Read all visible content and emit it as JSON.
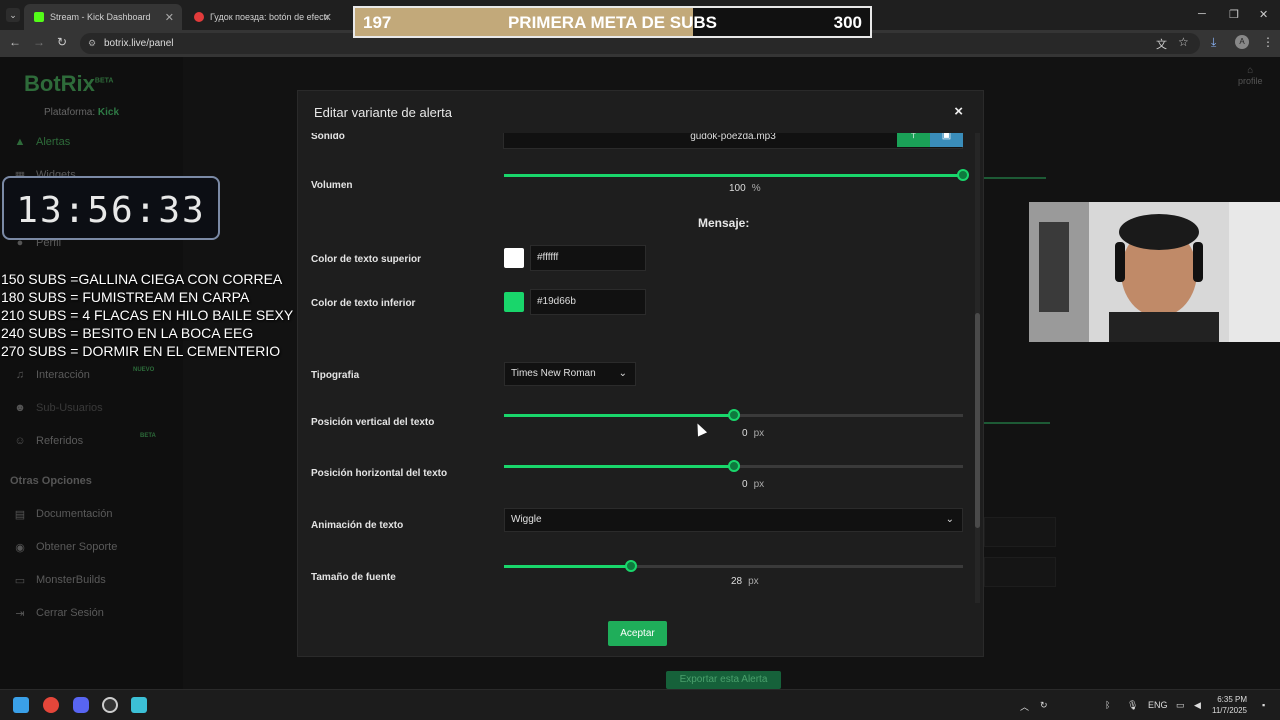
{
  "browser": {
    "tabs": [
      {
        "label": "Stream - Kick Dashboard",
        "color": "#53fc18"
      },
      {
        "label": "Гудок поезда: botón de efecto",
        "color": "#e23b3b"
      }
    ],
    "url": "botrix.live/panel"
  },
  "sidebar": {
    "logo": "BotRix",
    "logo_badge": "BETA",
    "platform_label": "Plataforma:",
    "platform_value": "Kick",
    "items": [
      {
        "label": "Alertas",
        "icon": "warning-icon"
      },
      {
        "label": "Widgets",
        "icon": "widget-icon"
      },
      {
        "label": "Perfil",
        "icon": "user-icon"
      },
      {
        "label": "Interacción",
        "icon": "music-note-icon",
        "badge": "NUEVO"
      },
      {
        "label": "Sub-Usuarios",
        "icon": "users-icon"
      },
      {
        "label": "Referidos",
        "icon": "group-icon",
        "badge": "BETA"
      }
    ],
    "section_title": "Otras Opciones",
    "other_items": [
      {
        "label": "Documentación",
        "icon": "doc-icon"
      },
      {
        "label": "Obtener Soporte",
        "icon": "support-icon"
      },
      {
        "label": "MonsterBuilds",
        "icon": "monitor-icon"
      },
      {
        "label": "Cerrar Sesión",
        "icon": "logout-icon"
      }
    ],
    "profile": "profile"
  },
  "modal": {
    "title": "Editar variante de alerta",
    "close": "×",
    "sound_label": "Sonido",
    "sound_file": "gudok-poezda.mp3",
    "volume_label": "Volumen",
    "volume_value": "100",
    "volume_unit": "%",
    "volume_fraction": 1.0,
    "message_title": "Mensaje:",
    "top_color_label": "Color de texto superior",
    "top_color_value": "#ffffff",
    "bottom_color_label": "Color de texto inferior",
    "bottom_color_value": "#19d66b",
    "font_label": "Tipografia",
    "font_value": "Times New Roman",
    "vpos_label": "Posición vertical del texto",
    "vpos_value": "0",
    "vpos_unit": "px",
    "hpos_label": "Posición horizontal del texto",
    "hpos_value": "0",
    "hpos_unit": "px",
    "anim_label": "Animación de texto",
    "anim_value": "Wiggle",
    "size_label": "Tamaño de fuente",
    "size_value": "28",
    "size_unit": "px",
    "accept": "Aceptar",
    "behind_button": "Exportar esta Alerta"
  },
  "overlay": {
    "goal_current": "197",
    "goal_title": "PRIMERA META DE SUBS",
    "goal_target": "300",
    "goal_fraction": 0.657,
    "timer": "13:56:33",
    "sub_goals": [
      "150 SUBS =GALLINA CIEGA CON CORREA",
      "180 SUBS = FUMISTREAM EN CARPA",
      "210 SUBS = 4 FLACAS EN HILO BAILE SEXY",
      "240 SUBS = BESITO EN LA BOCA EEG",
      "270 SUBS = DORMIR EN EL CEMENTERIO"
    ]
  },
  "taskbar": {
    "lang": "ENG",
    "time": "6:35 PM",
    "date": "11/7/2025"
  }
}
